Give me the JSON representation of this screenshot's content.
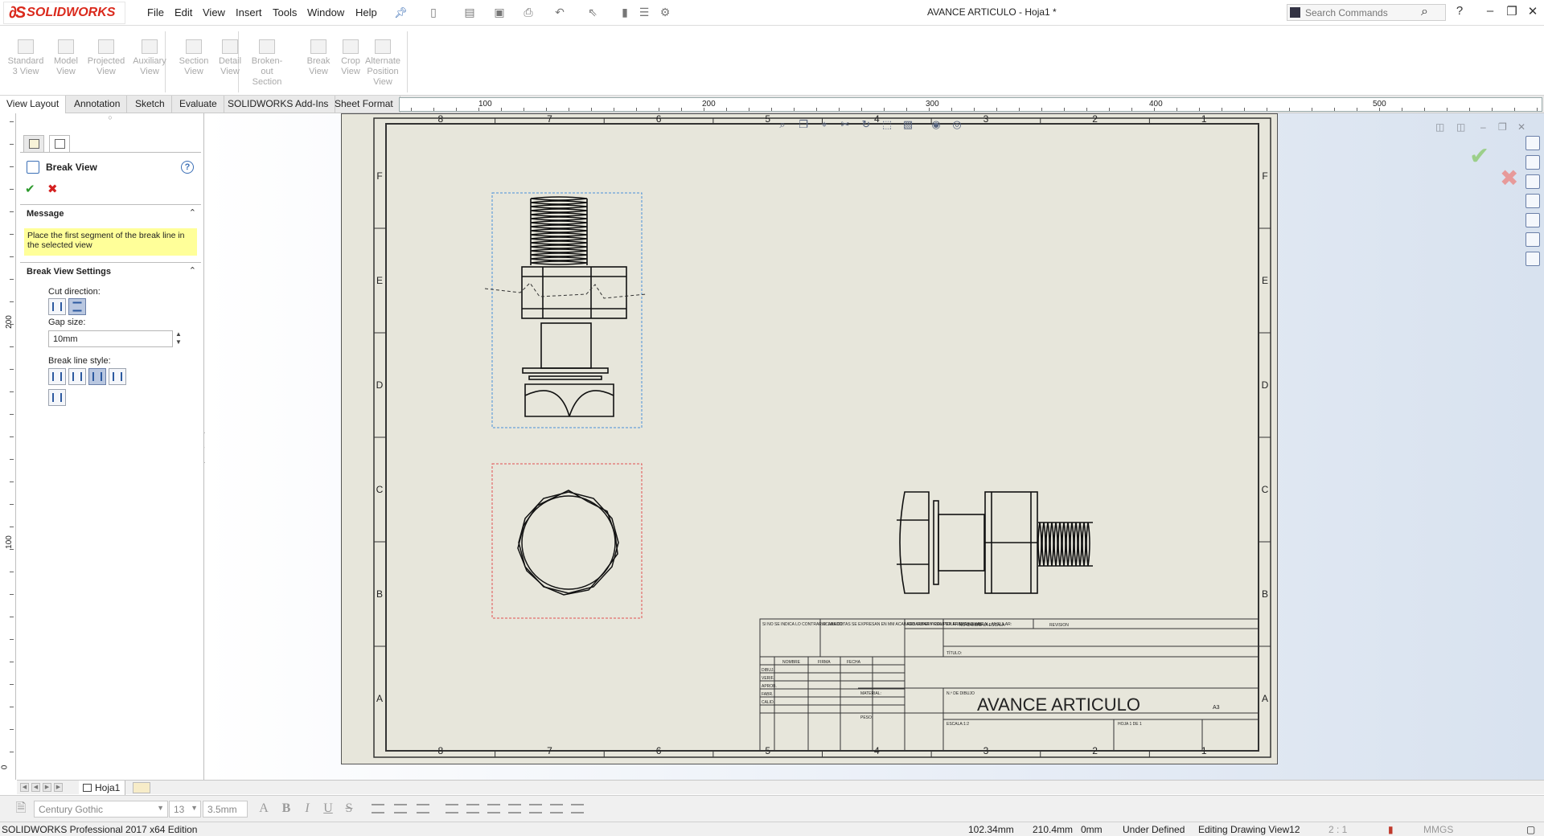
{
  "app": {
    "brand": "SOLIDWORKS",
    "menu": [
      "File",
      "Edit",
      "View",
      "Insert",
      "Tools",
      "Window",
      "Help"
    ],
    "document_title": "AVANCE ARTICULO - Hoja1 *",
    "search_placeholder": "Search Commands"
  },
  "command_manager": [
    {
      "label": "Standard\n3 View"
    },
    {
      "label": "Model\nView"
    },
    {
      "label": "Projected\nView"
    },
    {
      "label": "Auxiliary\nView"
    },
    {
      "label": "Section\nView"
    },
    {
      "label": "Detail\nView"
    },
    {
      "label": "Broken-out\nSection"
    },
    {
      "label": "Break\nView"
    },
    {
      "label": "Crop\nView"
    },
    {
      "label": "Alternate\nPosition\nView"
    }
  ],
  "tabs": [
    "View Layout",
    "Annotation",
    "Sketch",
    "Evaluate",
    "SOLIDWORKS Add-Ins",
    "Sheet Format"
  ],
  "active_tab": "View Layout",
  "ruler_h_labels": [
    "100",
    "200",
    "300",
    "400",
    "500"
  ],
  "ruler_v_labels": [
    "200",
    "100",
    "0"
  ],
  "property_manager": {
    "title": "Break View",
    "message_header": "Message",
    "message": "Place the first segment of the break line in the selected view",
    "settings_header": "Break View Settings",
    "cut_direction_label": "Cut direction:",
    "gap_size_label": "Gap size:",
    "gap_size_value": "10mm",
    "break_line_style_label": "Break line style:"
  },
  "drawing": {
    "column_labels": [
      "8",
      "7",
      "6",
      "5",
      "4",
      "3",
      "2",
      "1"
    ],
    "row_labels": [
      "F",
      "E",
      "D",
      "C",
      "B",
      "A"
    ],
    "title_block_name": "AVANCE ARTICULO",
    "sheet_size": "A3",
    "title_block_fields": {
      "general": "SI NO SE INDICA LO CONTRARIO: LAS COTAS SE EXPRESAN EN MM ACABADO SUPERFICIAL: TOLERANCIAS: LINEAL: ANGULAR:",
      "finish": "ACABADO:",
      "deburr": "REBARBAR Y ROMPER ARISTAS VIVAS",
      "no_scale": "NO CAMBIE LA ESCALA",
      "revision": "REVISION",
      "headers": [
        "NOMBRE",
        "FIRMA",
        "FECHA"
      ],
      "roles": [
        "DIBUJ.",
        "VERIF.",
        "APROB.",
        "FABR.",
        "CALID."
      ],
      "title": "TÍTULO:",
      "material": "MATERIAL:",
      "drawing_no": "N.º DE DIBUJO",
      "weight": "PESO:",
      "scale": "ESCALA:1:2",
      "sheet": "HOJA 1 DE 1"
    }
  },
  "sheet_tab": "Hoja1",
  "format_bar": {
    "font": "Century Gothic",
    "size": "13",
    "height": "3.5mm",
    "styles": [
      "A",
      "B",
      "I",
      "U",
      "S"
    ]
  },
  "status": {
    "product": "SOLIDWORKS Professional 2017 x64 Edition",
    "x": "102.34mm",
    "y": "210.4mm",
    "z": "0mm",
    "state": "Under Defined",
    "editing": "Editing Drawing View12",
    "scale": "2 : 1",
    "units": "MMGS"
  },
  "colors": {
    "brand": "#da291c",
    "sheet": "#e7e6db",
    "message_bg": "#ffff99",
    "ok": "#2d9a2d",
    "cancel": "#d42020",
    "selection_frame": "#4a90d9",
    "view_frame_red": "#e05050"
  }
}
